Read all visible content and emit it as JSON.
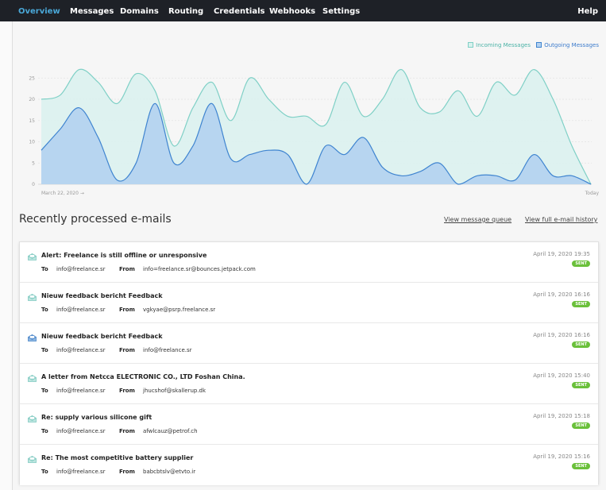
{
  "nav": {
    "items": [
      {
        "label": "Overview",
        "active": true
      },
      {
        "label": "Messages"
      },
      {
        "label": "Domains"
      },
      {
        "label": "Routing"
      },
      {
        "label": "Credentials"
      },
      {
        "label": "Webhooks"
      },
      {
        "label": "Settings"
      }
    ],
    "help_label": "Help"
  },
  "chart_data": {
    "type": "area",
    "series": [
      {
        "name": "Incoming Messages",
        "color": "#7fd0c6",
        "fill": "#d9f1ee",
        "values": [
          20,
          21,
          27,
          24,
          19,
          26,
          22,
          9,
          18,
          24,
          15,
          25,
          20,
          16,
          16,
          14,
          24,
          16,
          20,
          27,
          18,
          17,
          22,
          16,
          24,
          21,
          27,
          20,
          9,
          0
        ]
      },
      {
        "name": "Outgoing Messages",
        "color": "#3f84d0",
        "fill": "#b3d1ef",
        "values": [
          8,
          13,
          18,
          11,
          1,
          5,
          19,
          5,
          9,
          19,
          6,
          7,
          8,
          7,
          0,
          9,
          7,
          11,
          4,
          2,
          3,
          5,
          0,
          2,
          2,
          1,
          7,
          2,
          2,
          0
        ]
      }
    ],
    "yticks": [
      0,
      5,
      10,
      15,
      20,
      25
    ],
    "ylim": [
      0,
      30
    ],
    "x_start_label": "March 22, 2020 →",
    "x_end_label": "Today",
    "legend": "top-right",
    "grid": true
  },
  "recent": {
    "title": "Recently processed e-mails",
    "view_queue_label": "View message queue",
    "view_history_label": "View full e-mail history",
    "to_label": "To",
    "from_label": "From",
    "emails": [
      {
        "subject": "Alert: Freelance is still offline or unresponsive",
        "to": "info@freelance.sr",
        "from": "info=freelance.sr@bounces.jetpack.com",
        "date": "April 19, 2020 19:35",
        "status": "SENT",
        "icon": "envelope-open-icon"
      },
      {
        "subject": "Nieuw feedback bericht Feedback",
        "to": "info@freelance.sr",
        "from": "vgkyae@psrp.freelance.sr",
        "date": "April 19, 2020 16:16",
        "status": "SENT",
        "icon": "envelope-open-icon"
      },
      {
        "subject": "Nieuw feedback bericht Feedback",
        "to": "info@freelance.sr",
        "from": "info@freelance.sr",
        "date": "April 19, 2020 16:16",
        "status": "SENT",
        "icon": "envelope-open-blue-icon"
      },
      {
        "subject": "A letter from Netcca ELECTRONIC CO., LTD Foshan China.",
        "to": "info@freelance.sr",
        "from": "jhucshof@skallerup.dk",
        "date": "April 19, 2020 15:40",
        "status": "SENT",
        "icon": "envelope-open-icon"
      },
      {
        "subject": "Re: supply various silicone gift",
        "to": "info@freelance.sr",
        "from": "afwlcauz@petrof.ch",
        "date": "April 19, 2020 15:18",
        "status": "SENT",
        "icon": "envelope-open-icon"
      },
      {
        "subject": "Re: The most competitive battery supplier",
        "to": "info@freelance.sr",
        "from": "babcbtslv@etvto.ir",
        "date": "April 19, 2020 15:16",
        "status": "SENT",
        "icon": "envelope-open-icon"
      }
    ]
  }
}
